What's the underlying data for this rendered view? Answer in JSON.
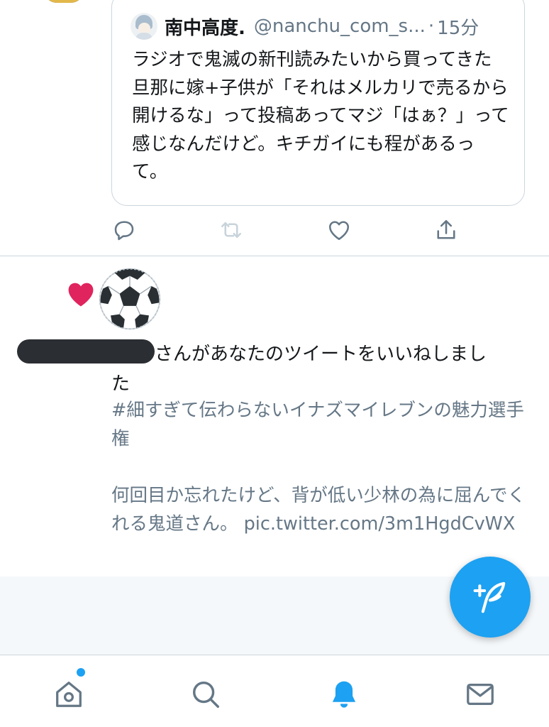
{
  "quoted_tweet": {
    "author_name": "南中高度.",
    "author_handle": "@nanchu_com_s...",
    "separator": "·",
    "time": "15分",
    "text": "ラジオで鬼滅の新刊読みたいから買ってきた旦那に嫁+子供が「それはメルカリで売るから開けるな」って投稿あってマジ「はぁ？」って感じなんだけど。キチガイにも程があるって。"
  },
  "tweet_actions": {
    "reply_icon": "reply-icon",
    "retweet_icon": "retweet-icon",
    "like_icon": "heart-outline-icon",
    "share_icon": "share-icon"
  },
  "notification": {
    "type_icon": "heart-filled-icon",
    "avatar_icon": "soccer-ball-icon",
    "line1": "さんがあなたのツイートをいいねしまし",
    "line2": "た",
    "liked_tweet": {
      "hashtag": "#細すぎて伝わらないイナズマイレブンの魅力選手権",
      "body": "何回目か忘れたけど、背が低い少林の為に屈んでくれる鬼道さん。 pic.twitter.com/3m1HgdCvWX"
    }
  },
  "compose_fab": {
    "icon": "compose-tweet-icon"
  },
  "tab_bar": {
    "tabs": [
      {
        "name": "home",
        "icon": "home-icon",
        "active": false,
        "has_badge_dot": true
      },
      {
        "name": "search",
        "icon": "search-icon",
        "active": false
      },
      {
        "name": "notifications",
        "icon": "bell-icon",
        "active": true
      },
      {
        "name": "messages",
        "icon": "mail-icon",
        "active": false
      }
    ]
  },
  "colors": {
    "accent": "#1da1f2",
    "like_heart": "#e0245e",
    "secondary_text": "#657786",
    "border": "#ccd6dd",
    "icon_gray": "#657786",
    "band": "#f5f8fa"
  }
}
